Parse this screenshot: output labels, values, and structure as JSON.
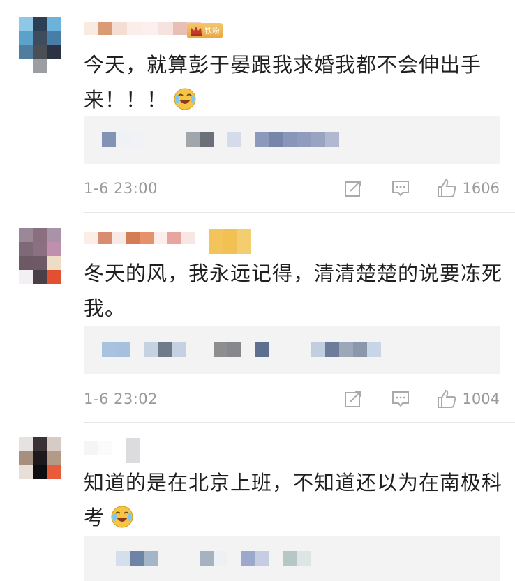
{
  "comments": [
    {
      "badge_label": "铁粉",
      "text": "今天，就算彭于晏跟我求婚我都不会伸出手来！！！",
      "emoji": "laugh-cry-emoji",
      "time": "1-6 23:00",
      "likes": "1606"
    },
    {
      "text": "冬天的风，我永远记得，清清楚楚的说要冻死我。",
      "time": "1-6 23:02",
      "likes": "1004"
    },
    {
      "text": "知道的是在北京上班，不知道还以为在南极科考",
      "emoji": "laugh-cry-emoji"
    }
  ],
  "icons": {
    "repost": "repost-icon",
    "comment": "comment-icon",
    "like": "thumbs-up-icon"
  },
  "colors": {
    "text": "#1f1f1f",
    "meta": "#999999",
    "reply_bg": "#f3f3f3",
    "badge": "#eab14d"
  }
}
